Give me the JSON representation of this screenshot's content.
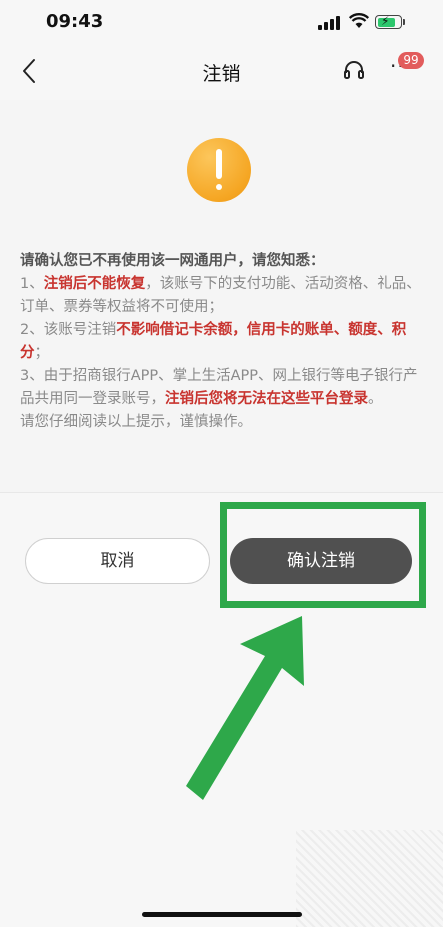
{
  "status_bar": {
    "time": "09:43"
  },
  "nav": {
    "title": "注销",
    "badge_count": "99",
    "more_label": "···"
  },
  "notice": {
    "intro": "请确认您已不再使用该一网通用户，请您知悉：",
    "item1_prefix": "1、",
    "item1_highlight": "注销后不能恢复",
    "item1_rest": "，该账号下的支付功能、活动资格、礼品、订单、票券等权益将不可使用；",
    "item2_prefix": "2、该账号注销",
    "item2_highlight": "不影响借记卡余额，信用卡的账单、额度、积分",
    "item2_rest": "；",
    "item3_prefix": "3、由于招商银行APP、掌上生活APP、网上银行等电子银行产品共用同一登录账号，",
    "item3_highlight": "注销后您将无法在这些平台登录",
    "item3_rest": "。",
    "footer": "请您仔细阅读以上提示，谨慎操作。"
  },
  "buttons": {
    "cancel": "取消",
    "confirm": "确认注销"
  },
  "colors": {
    "warning": "#f5a623",
    "highlight_red": "#c8342f",
    "annotation_green": "#2ea84a",
    "confirm_bg": "#505050"
  },
  "icons": {
    "back": "chevron-left-icon",
    "support": "headset-icon",
    "warning": "exclamation-icon",
    "more": "more-dots-icon"
  }
}
